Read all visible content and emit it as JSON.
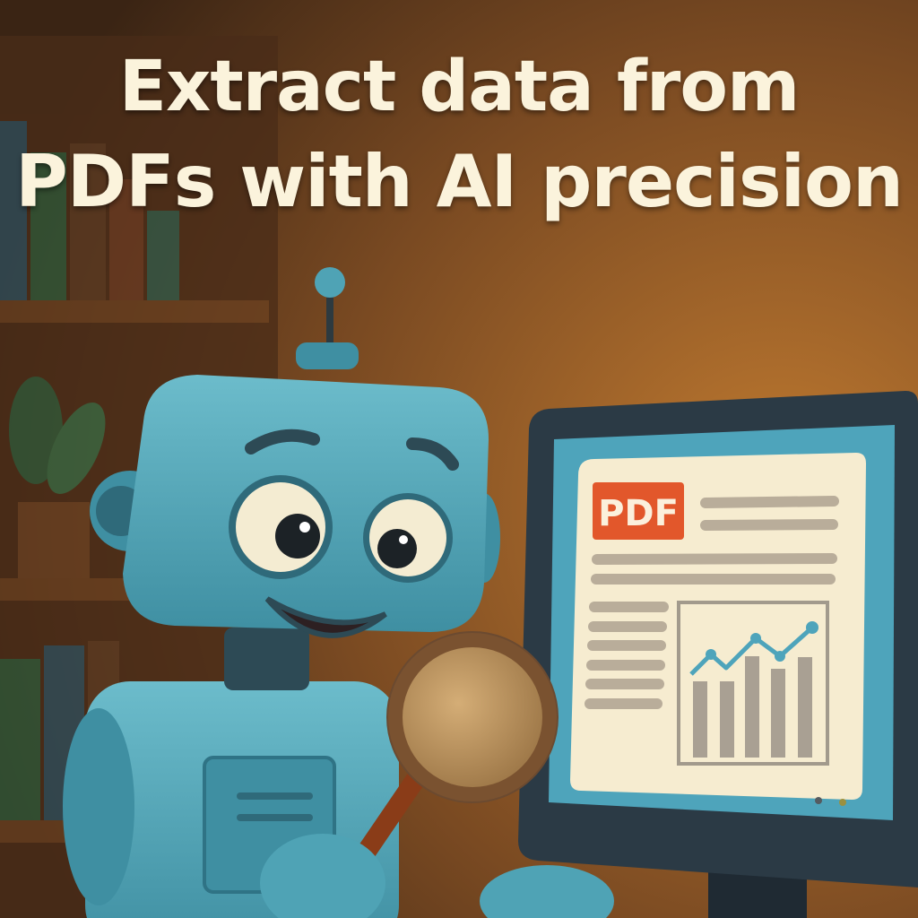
{
  "headline": {
    "line1": "Extract data from",
    "line2": "PDFs with AI precision"
  },
  "monitor": {
    "badge_label": "PDF"
  },
  "colors": {
    "headline": "#fbf3dc",
    "robot": "#4fa3b5",
    "pdf_badge": "#e2572b",
    "screen": "#4ea4bb",
    "paper": "#f6ecd0",
    "background_dark": "#3a2414",
    "background_light": "#b8702a"
  }
}
